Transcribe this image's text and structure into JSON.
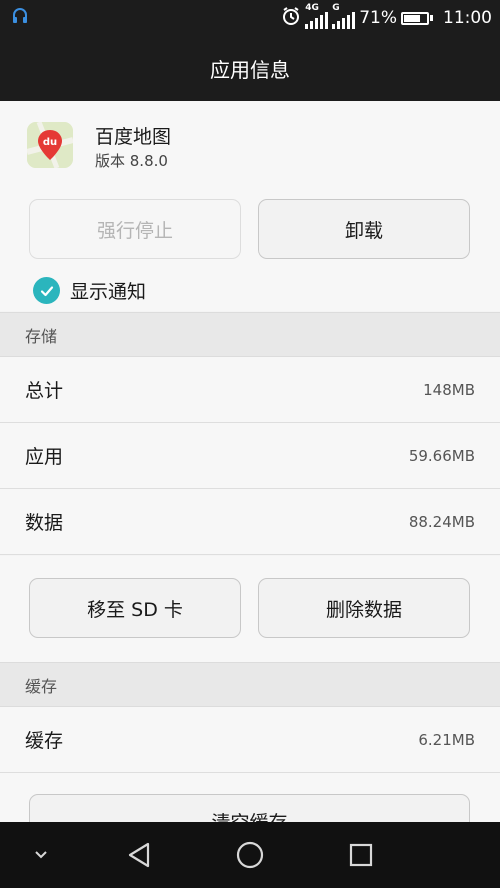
{
  "status_bar": {
    "network_label_1": "4G",
    "network_label_2": "G",
    "battery_percent_text": "71%",
    "battery_level": 0.71,
    "time": "11:00",
    "icons": [
      "headset-notification-icon",
      "alarm-icon",
      "signal-4g-icon",
      "signal-g-icon",
      "battery-icon"
    ]
  },
  "app_bar": {
    "title": "应用信息"
  },
  "app": {
    "name": "百度地图",
    "version": "版本 8.8.0",
    "icon_text": "du",
    "icon_colors": {
      "background": "#dfe9c6",
      "pin": "#e53935"
    }
  },
  "actions": {
    "force_stop": "强行停止",
    "uninstall": "卸载"
  },
  "notifications": {
    "label": "显示通知",
    "checked": true,
    "accent": "#2bb5bd"
  },
  "storage": {
    "header": "存储",
    "rows": [
      {
        "label": "总计",
        "value": "148MB"
      },
      {
        "label": "应用",
        "value": "59.66MB"
      },
      {
        "label": "数据",
        "value": "88.24MB"
      }
    ],
    "move_to_sd": "移至 SD 卡",
    "clear_data": "删除数据"
  },
  "cache": {
    "header": "缓存",
    "rows": [
      {
        "label": "缓存",
        "value": "6.21MB"
      }
    ],
    "clear_cache": "清空缓存"
  },
  "nav_bar": {
    "icons": [
      "chevron-down-icon",
      "back-icon",
      "home-icon",
      "recents-icon"
    ]
  }
}
